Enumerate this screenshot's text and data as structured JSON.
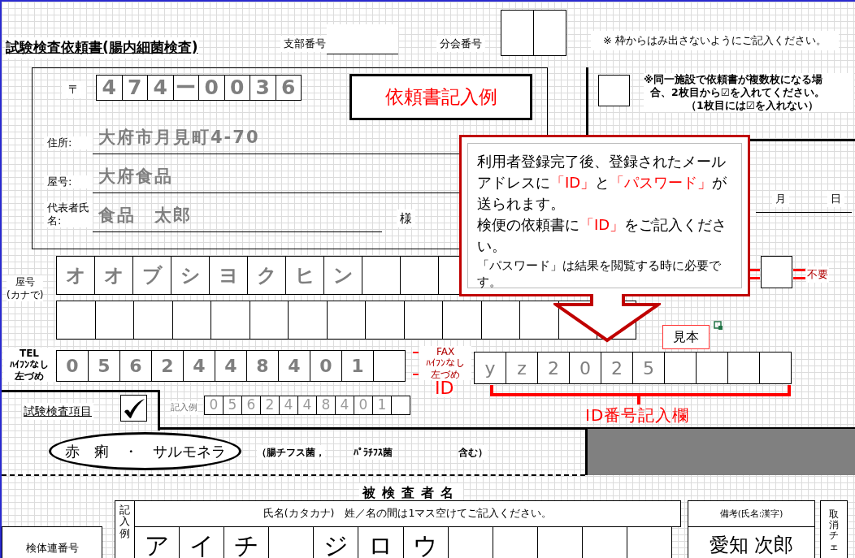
{
  "title": "試験検査依頼書(腸内細菌検査)",
  "branch": {
    "label": "支部番号"
  },
  "subbranch": {
    "label": "分会番号"
  },
  "notice": "※ 枠からはみ出さないようにご記入ください。",
  "address_block": {
    "postal_mark": "〒",
    "postal_digits": [
      "4",
      "7",
      "4",
      "ー",
      "0",
      "0",
      "3",
      "6"
    ],
    "example_badge": "依頼書記入例",
    "honorific": "様",
    "fields": [
      {
        "label": "住所:",
        "value": "大府市月見町4-70"
      },
      {
        "label": "屋号:",
        "value": "大府食品"
      },
      {
        "label": "代表者氏名:",
        "value": "食品　太郎"
      }
    ]
  },
  "multi_sheet": {
    "checked": false,
    "note": [
      "※同一施設で依頼書が複数枚になる場",
      "合、2枚目から☑を入れてください。",
      "（1枚目には☑を入れない）"
    ]
  },
  "date": {
    "month": "月",
    "day": "日"
  },
  "kana": {
    "label": [
      "屋号",
      "(カナで)"
    ],
    "chars": [
      "オ",
      "オ",
      "ブ",
      "シ",
      "ヨ",
      "ク",
      "ヒ",
      "ン"
    ]
  },
  "unneeded": {
    "checked": false,
    "label": "不要",
    "struck": true
  },
  "tel": {
    "label": [
      "TEL",
      "ﾊｲﾌﾝなし",
      "左づめ"
    ],
    "digits": [
      "0",
      "5",
      "6",
      "2",
      "4",
      "4",
      "8",
      "4",
      "0",
      "1"
    ]
  },
  "id_field": {
    "old_label": [
      "FAX",
      "ﾊｲﾌﾝなし",
      "左づめ"
    ],
    "old_label_struck": true,
    "label": "ID",
    "chars": [
      "y",
      "z",
      "2",
      "0",
      "2",
      "5"
    ],
    "sample_stamp": "見本",
    "caption": "ID番号記入欄"
  },
  "callout": {
    "paragraphs": [
      [
        {
          "text": "利用者登録完了後、登録されたメールアドレスに",
          "highlight": false
        },
        {
          "text": "「ID」",
          "highlight": true
        },
        {
          "text": "と",
          "highlight": false
        },
        {
          "text": "「パスワード」",
          "highlight": true
        },
        {
          "text": "が送られます。",
          "highlight": false
        }
      ],
      [
        {
          "text": "検便の依頼書に",
          "highlight": false
        },
        {
          "text": "「ID」",
          "highlight": true
        },
        {
          "text": "をご記入ください。",
          "highlight": false
        }
      ],
      [
        {
          "text": "「パスワード」は結果を閲覧する時に必要です。",
          "highlight": false
        }
      ]
    ]
  },
  "test_items": {
    "label": "試験検査項目",
    "checked": true,
    "example_label": "記入例",
    "example_digits": [
      "0",
      "5",
      "6",
      "2",
      "4",
      "4",
      "8",
      "4",
      "0",
      "1"
    ]
  },
  "target": {
    "name": "赤　痢　・　サルモネラ",
    "notes": [
      "（腸チフス菌，",
      "ﾊﾟﾗﾁﾌｽ菌",
      "含む）"
    ]
  },
  "subjects": {
    "title": "被検査者名",
    "serial_label": "検体連番号",
    "example_label": "記入例",
    "name_header": "氏名(カタカナ)　姓／名の間は1マス空けてご記入ください。",
    "family": [
      "ア",
      "イ",
      "チ"
    ],
    "given": [
      "ジ",
      "ロ",
      "ウ"
    ],
    "remarks_header": "備考(氏名:漢字)",
    "remarks_value": "愛知 次郎",
    "cancel_label": "取消チェ"
  }
}
